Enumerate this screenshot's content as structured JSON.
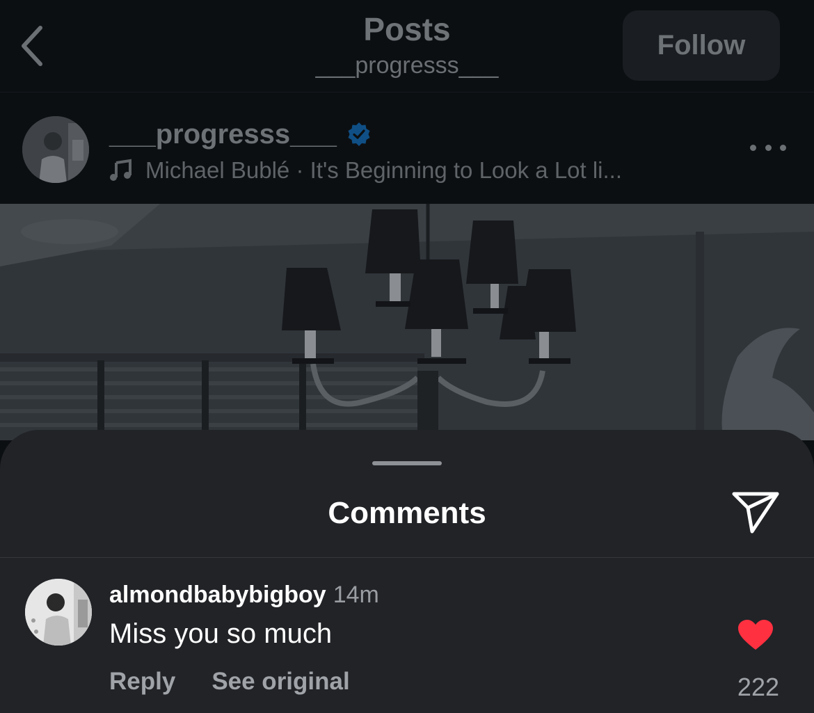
{
  "nav": {
    "title": "Posts",
    "subtitle": "___progresss___",
    "follow_label": "Follow"
  },
  "post": {
    "username": "___progresss___",
    "verified": true,
    "music_text": "Michael Bublé · It's Beginning to Look a Lot li..."
  },
  "comments_sheet": {
    "title": "Comments",
    "comments": [
      {
        "username": "almondbabybigboy",
        "time": "14m",
        "text": "Miss you so much",
        "reply_label": "Reply",
        "see_original_label": "See original",
        "liked": true,
        "like_count": "222"
      }
    ]
  },
  "icons": {
    "back": "chevron-left-icon",
    "verified": "verified-badge-icon",
    "music": "music-note-icon",
    "more": "more-horizontal-icon",
    "share": "send-icon",
    "like": "heart-icon"
  },
  "colors": {
    "background": "#0c0f12",
    "sheet": "#212327",
    "verified_blue": "#0f4f85",
    "like_red": "#ff3040"
  }
}
